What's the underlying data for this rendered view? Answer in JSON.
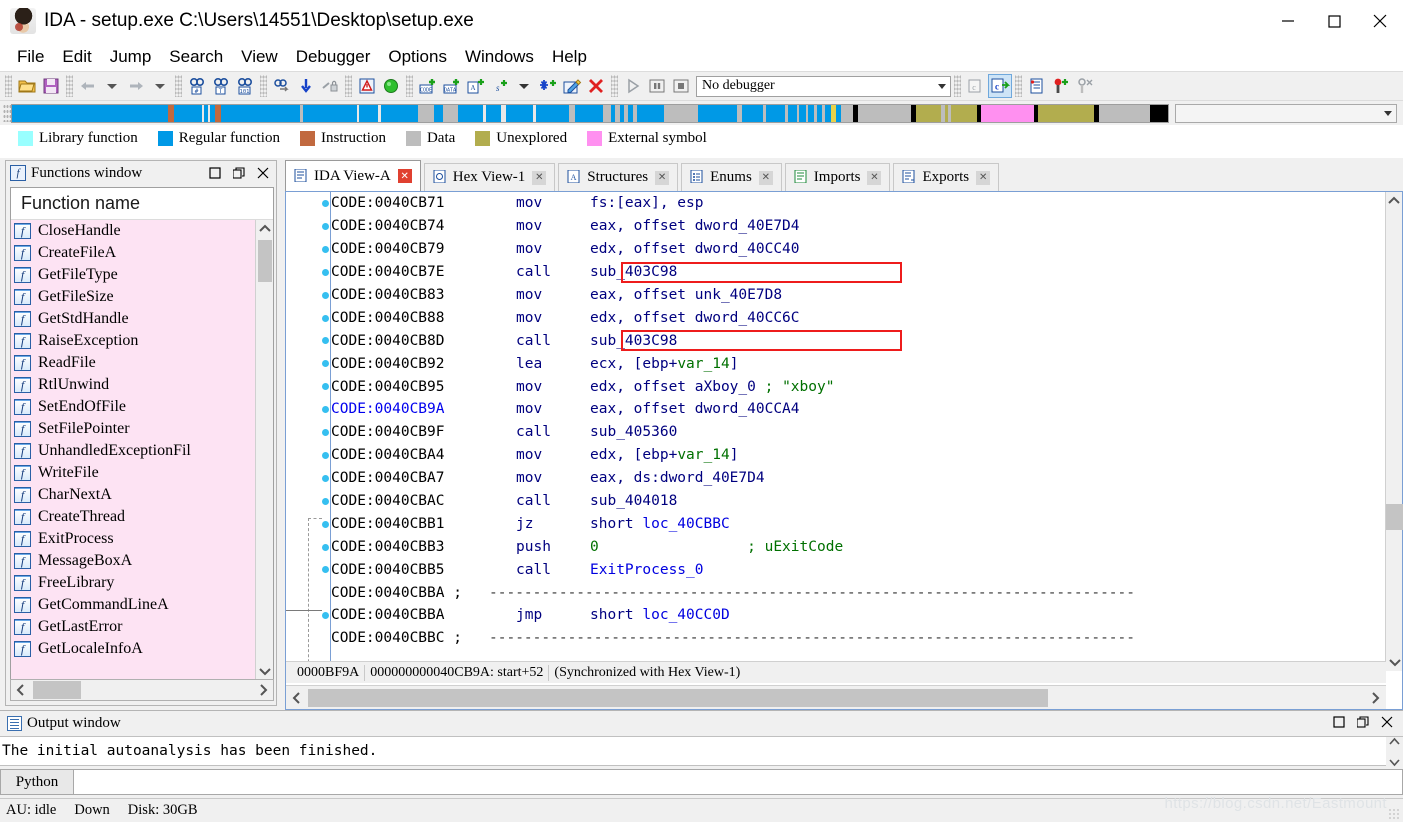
{
  "window": {
    "title": "IDA - setup.exe C:\\Users\\14551\\Desktop\\setup.exe",
    "app_icon": "ida-logo-icon",
    "minimize": "—",
    "maximize": "□",
    "close": "✕"
  },
  "menubar": {
    "items": [
      {
        "label": "File"
      },
      {
        "label": "Edit"
      },
      {
        "label": "Jump"
      },
      {
        "label": "Search"
      },
      {
        "label": "View"
      },
      {
        "label": "Debugger"
      },
      {
        "label": "Options"
      },
      {
        "label": "Windows"
      },
      {
        "label": "Help"
      }
    ]
  },
  "toolbar": {
    "icons": [
      "open-file-icon",
      "save-icon",
      "back-arrow-icon",
      "back-dropdown-icon",
      "forward-arrow-icon",
      "forward-dropdown-icon",
      "search-hex-icon",
      "search-text-icon",
      "search-sequence-icon",
      "binary-search-icon",
      "jump-down-icon",
      "jump-lock-icon",
      "warning-icon",
      "green-circle-icon",
      "make-code-icon",
      "make-data-icon",
      "make-ascii-icon",
      "make-struct-icon",
      "struct-dropdown-icon",
      "make-array-icon",
      "edit-function-icon",
      "undefine-icon",
      "run-icon",
      "pause-icon",
      "stop-icon",
      "decompile-icon",
      "decompile-active-icon",
      "breakpoints-icon",
      "add-breakpoint-icon",
      "watch-icon"
    ],
    "debugger_select": {
      "value": "No debugger",
      "dropdown_icon": "chevron-down-icon"
    }
  },
  "navband": {
    "right_combo_value": "",
    "segments": [
      {
        "color": "#0099e6",
        "w": 183
      },
      {
        "color": "#c1693f",
        "w": 7
      },
      {
        "color": "#0099e6",
        "w": 33
      },
      {
        "color": "#e8e8e8",
        "w": 3
      },
      {
        "color": "#0099e6",
        "w": 4
      },
      {
        "color": "#e8e8e8",
        "w": 3
      },
      {
        "color": "#0099e6",
        "w": 6
      },
      {
        "color": "#c1693f",
        "w": 7
      },
      {
        "color": "#0099e6",
        "w": 92
      },
      {
        "color": "#bdbdbd",
        "w": 4
      },
      {
        "color": "#0099e6",
        "w": 63
      },
      {
        "color": "#e8e8e8",
        "w": 3
      },
      {
        "color": "#0099e6",
        "w": 22
      },
      {
        "color": "#e8e8e8",
        "w": 3
      },
      {
        "color": "#0099e6",
        "w": 44
      },
      {
        "color": "#bdbdbd",
        "w": 19
      },
      {
        "color": "#0099e6",
        "w": 10
      },
      {
        "color": "#bdbdbd",
        "w": 18
      },
      {
        "color": "#0099e6",
        "w": 29
      },
      {
        "color": "#e8e8e8",
        "w": 4
      },
      {
        "color": "#0099e6",
        "w": 18
      },
      {
        "color": "#e8e8e8",
        "w": 5
      },
      {
        "color": "#0099e6",
        "w": 32
      },
      {
        "color": "#e8e8e8",
        "w": 4
      },
      {
        "color": "#0099e6",
        "w": 38
      },
      {
        "color": "#bdbdbd",
        "w": 7
      },
      {
        "color": "#0099e6",
        "w": 34
      },
      {
        "color": "#bdbdbd",
        "w": 9
      },
      {
        "color": "#0099e6",
        "w": 5
      },
      {
        "color": "#bdbdbd",
        "w": 5
      },
      {
        "color": "#0099e6",
        "w": 5
      },
      {
        "color": "#bdbdbd",
        "w": 5
      },
      {
        "color": "#0099e6",
        "w": 6
      },
      {
        "color": "#bdbdbd",
        "w": 4
      },
      {
        "color": "#0099e6",
        "w": 32
      },
      {
        "color": "#bdbdbd",
        "w": 40
      },
      {
        "color": "#0099e6",
        "w": 46
      },
      {
        "color": "#bdbdbd",
        "w": 6
      },
      {
        "color": "#0099e6",
        "w": 24
      },
      {
        "color": "#bdbdbd",
        "w": 4
      },
      {
        "color": "#0099e6",
        "w": 22
      },
      {
        "color": "#bdbdbd",
        "w": 4
      },
      {
        "color": "#0099e6",
        "w": 10
      },
      {
        "color": "#bdbdbd",
        "w": 3
      },
      {
        "color": "#0099e6",
        "w": 8
      },
      {
        "color": "#bdbdbd",
        "w": 3
      },
      {
        "color": "#0099e6",
        "w": 7
      },
      {
        "color": "#bdbdbd",
        "w": 3
      },
      {
        "color": "#0099e6",
        "w": 6
      },
      {
        "color": "#bdbdbd",
        "w": 3
      },
      {
        "color": "#0099e6",
        "w": 8
      },
      {
        "color": "#e8d24a",
        "w": 5
      },
      {
        "color": "#0099e6",
        "w": 6
      },
      {
        "color": "#bdbdbd",
        "w": 14
      },
      {
        "color": "#000000",
        "w": 6
      },
      {
        "color": "#bdbdbd",
        "w": 62
      },
      {
        "color": "#000000",
        "w": 6
      },
      {
        "color": "#b2ad4e",
        "w": 30
      },
      {
        "color": "#bdbdbd",
        "w": 4
      },
      {
        "color": "#b2ad4e",
        "w": 4
      },
      {
        "color": "#bdbdbd",
        "w": 4
      },
      {
        "color": "#b2ad4e",
        "w": 30
      },
      {
        "color": "#000000",
        "w": 5
      },
      {
        "color": "#ff90f0",
        "w": 62
      },
      {
        "color": "#000000",
        "w": 5
      },
      {
        "color": "#b2ad4e",
        "w": 66
      },
      {
        "color": "#000000",
        "w": 5
      },
      {
        "color": "#bdbdbd",
        "w": 60
      },
      {
        "color": "#000000",
        "w": 22
      }
    ]
  },
  "legend": {
    "items": [
      {
        "label": "Library function",
        "color": "#99ffff"
      },
      {
        "label": "Regular function",
        "color": "#0099e6"
      },
      {
        "label": "Instruction",
        "color": "#c1693f"
      },
      {
        "label": "Data",
        "color": "#bdbdbd"
      },
      {
        "label": "Unexplored",
        "color": "#b2ad4e"
      },
      {
        "label": "External symbol",
        "color": "#ff90f0"
      }
    ]
  },
  "functions_window": {
    "title": "Functions window",
    "title_icon": "function-icon",
    "restore_icon": "restore-icon",
    "dock_icon": "dock-icon",
    "close_icon": "close-icon",
    "column_header": "Function name",
    "items": [
      {
        "name": "CloseHandle"
      },
      {
        "name": "CreateFileA"
      },
      {
        "name": "GetFileType"
      },
      {
        "name": "GetFileSize"
      },
      {
        "name": "GetStdHandle"
      },
      {
        "name": "RaiseException"
      },
      {
        "name": "ReadFile"
      },
      {
        "name": "RtlUnwind"
      },
      {
        "name": "SetEndOfFile"
      },
      {
        "name": "SetFilePointer"
      },
      {
        "name": "UnhandledExceptionFil"
      },
      {
        "name": "WriteFile"
      },
      {
        "name": "CharNextA"
      },
      {
        "name": "CreateThread"
      },
      {
        "name": "ExitProcess"
      },
      {
        "name": "MessageBoxA"
      },
      {
        "name": "FreeLibrary"
      },
      {
        "name": "GetCommandLineA"
      },
      {
        "name": "GetLastError"
      },
      {
        "name": "GetLocaleInfoA"
      }
    ]
  },
  "tabs": [
    {
      "label": "IDA View-A",
      "icon": "ida-view-icon",
      "active": true,
      "close": "✕"
    },
    {
      "label": "Hex View-1",
      "icon": "hex-view-icon",
      "active": false,
      "close": "✕"
    },
    {
      "label": "Structures",
      "icon": "structures-icon",
      "active": false,
      "close": "✕"
    },
    {
      "label": "Enums",
      "icon": "enums-icon",
      "active": false,
      "close": "✕"
    },
    {
      "label": "Imports",
      "icon": "imports-icon",
      "active": false,
      "close": "✕"
    },
    {
      "label": "Exports",
      "icon": "exports-icon",
      "active": false,
      "close": "✕"
    }
  ],
  "disassembly": {
    "current_address": "CODE:0040CB9A",
    "highlight_color": "#ee1c1c",
    "lines": [
      {
        "addr": "CODE:0040CB71",
        "mnem": "mov",
        "ops": "fs:[eax], esp",
        "dot": true
      },
      {
        "addr": "CODE:0040CB74",
        "mnem": "mov",
        "ops": "eax, offset dword_40E7D4",
        "dot": true
      },
      {
        "addr": "CODE:0040CB79",
        "mnem": "mov",
        "ops": "edx, offset dword_40CC40",
        "dot": true
      },
      {
        "addr": "CODE:0040CB7E",
        "mnem": "call",
        "ops": "sub_403C98",
        "dot": true,
        "boxed": true
      },
      {
        "addr": "CODE:0040CB83",
        "mnem": "mov",
        "ops": "eax, offset unk_40E7D8",
        "dot": true
      },
      {
        "addr": "CODE:0040CB88",
        "mnem": "mov",
        "ops": "edx, offset dword_40CC6C",
        "dot": true
      },
      {
        "addr": "CODE:0040CB8D",
        "mnem": "call",
        "ops": "sub_403C98",
        "dot": true,
        "boxed": true
      },
      {
        "addr": "CODE:0040CB92",
        "mnem": "lea",
        "ops": "ecx, [ebp+var_14]",
        "dot": true,
        "var": "var_14"
      },
      {
        "addr": "CODE:0040CB95",
        "mnem": "mov",
        "ops": "edx, offset aXboy_0 ; \"xboy\"",
        "dot": true,
        "comment": "; \"xboy\""
      },
      {
        "addr": "CODE:0040CB9A",
        "mnem": "mov",
        "ops": "eax, offset dword_40CCA4",
        "dot": true,
        "current": true
      },
      {
        "addr": "CODE:0040CB9F",
        "mnem": "call",
        "ops": "sub_405360",
        "dot": true
      },
      {
        "addr": "CODE:0040CBA4",
        "mnem": "mov",
        "ops": "edx, [ebp+var_14]",
        "dot": true,
        "var": "var_14"
      },
      {
        "addr": "CODE:0040CBA7",
        "mnem": "mov",
        "ops": "eax, ds:dword_40E7D4",
        "dot": true
      },
      {
        "addr": "CODE:0040CBAC",
        "mnem": "call",
        "ops": "sub_404018",
        "dot": true
      },
      {
        "addr": "CODE:0040CBB1",
        "mnem": "jz",
        "ops": "short loc_40CBBC",
        "dot": true
      },
      {
        "addr": "CODE:0040CBB3",
        "mnem": "push",
        "ops": "0                 ; uExitCode",
        "dot": true,
        "comment": "; uExitCode"
      },
      {
        "addr": "CODE:0040CBB5",
        "mnem": "call",
        "ops": "ExitProcess_0",
        "dot": true
      },
      {
        "addr": "CODE:0040CBBA ;",
        "mnem": "",
        "ops": "--------------------------------------------------------------------------",
        "dot": false,
        "separator": true
      },
      {
        "addr": "CODE:0040CBBA",
        "mnem": "jmp",
        "ops": "short loc_40CC0D",
        "dot": true
      },
      {
        "addr": "CODE:0040CBBC ;",
        "mnem": "",
        "ops": "--------------------------------------------------------------------------",
        "dot": false,
        "separator": true
      }
    ],
    "status": [
      "0000BF9A",
      "000000000040CB9A: start+52",
      "(Synchronized with Hex View-1)"
    ]
  },
  "output_window": {
    "title": "Output window",
    "icon": "output-icon",
    "restore_icon": "restore-icon",
    "dock_icon": "dock-icon",
    "close_icon": "close-icon",
    "text": "The initial autoanalysis has been finished.",
    "cli_label": "Python",
    "cli_value": ""
  },
  "statusbar": {
    "au": "AU: idle",
    "direction": "Down",
    "disk": "Disk: 30GB",
    "watermark": "https://blog.csdn.net/Eastmount"
  }
}
